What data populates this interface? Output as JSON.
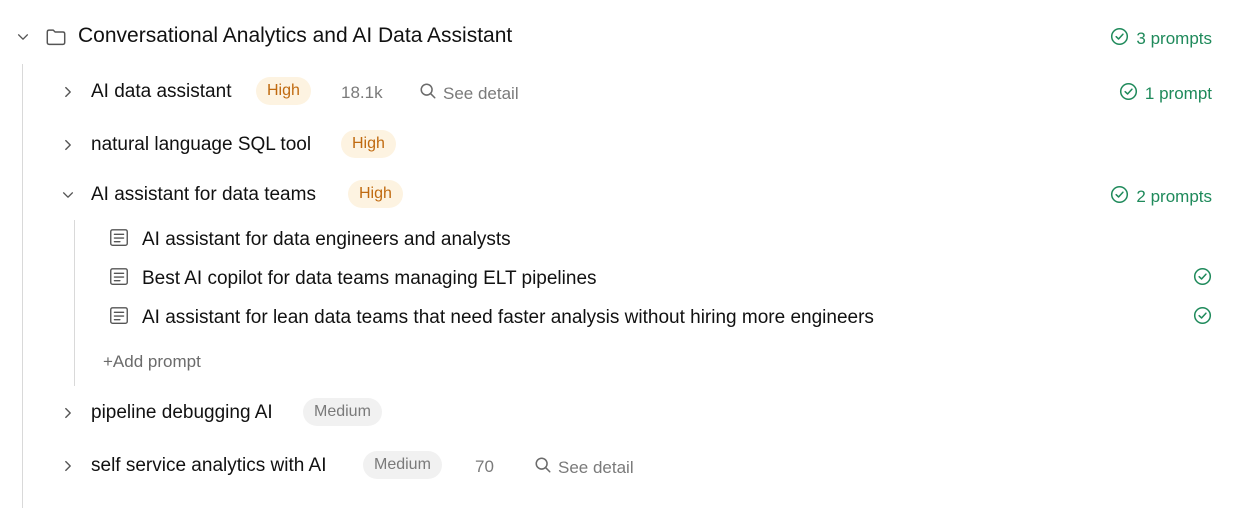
{
  "group": {
    "title": "Conversational Analytics and AI Data Assistant",
    "prompt_count": "3 prompts"
  },
  "keywords": [
    {
      "name": "AI data assistant",
      "priority": "High",
      "volume": "18.1k",
      "detail_label": "See detail",
      "prompt_count": "1 prompt",
      "expanded": false
    },
    {
      "name": "natural language SQL tool",
      "priority": "High",
      "expanded": false
    },
    {
      "name": "AI assistant for data teams",
      "priority": "High",
      "prompt_count": "2 prompts",
      "expanded": true,
      "prompts": [
        {
          "text": "AI assistant for data engineers and analysts",
          "checked": false
        },
        {
          "text": "Best AI copilot for data teams managing ELT pipelines",
          "checked": true
        },
        {
          "text": "AI assistant for lean data teams that need faster analysis without hiring more engineers",
          "checked": true
        }
      ],
      "add_prompt_label": "+Add prompt"
    },
    {
      "name": "pipeline debugging AI",
      "priority": "Medium",
      "expanded": false
    },
    {
      "name": "self service analytics with AI",
      "priority": "Medium",
      "volume": "70",
      "detail_label": "See detail",
      "expanded": false
    }
  ],
  "colors": {
    "accent_green": "#1f8a5b",
    "high_badge_bg": "#fdf3e1",
    "high_badge_text": "#c06a10",
    "medium_badge_bg": "#f1f1f1",
    "medium_badge_text": "#7a7a7a"
  },
  "icons": {
    "collapse": "chevron-down-icon",
    "expand": "chevron-right-icon",
    "folder": "folder-icon",
    "prompt": "prompt-doc-icon",
    "search": "search-icon",
    "check": "check-circle-icon"
  }
}
